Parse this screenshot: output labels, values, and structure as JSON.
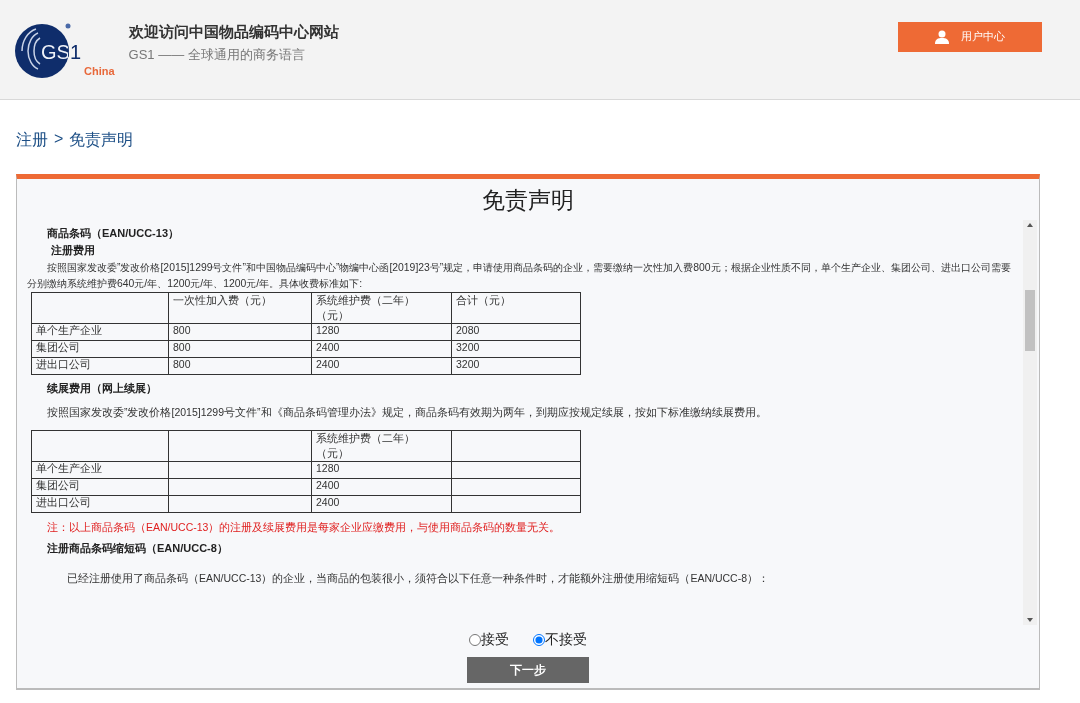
{
  "header": {
    "logo": {
      "mark": "GS1",
      "region": "China"
    },
    "title": "欢迎访问中国物品编码中心网站",
    "subtitle": "GS1 —— 全球通用的商务语言",
    "user_center_button": "用户中心"
  },
  "breadcrumb": {
    "items": [
      "注册",
      "免责声明"
    ],
    "separator": ">"
  },
  "panel": {
    "title": "免责声明",
    "blocks": [
      {
        "kind": "heading",
        "text": "商品条码（EAN/UCC-13）"
      },
      {
        "kind": "subheading",
        "text": "注册费用"
      },
      {
        "kind": "paragraph",
        "text": "按照国家发改委”发改价格[2015]1299号文件”和中国物品编码中心”物编中心函[2019]23号”规定，申请使用商品条码的企业，需要缴纳一次性加入费800元；根据企业性质不同，单个生产企业、集团公司、进出口公司需要分别缴纳系统维护费640元/年、1200元/年、1200元/年。具体收费标准如下:"
      },
      {
        "kind": "table",
        "columns": [
          "",
          "一次性加入费（元）",
          "系统维护费（二年）（元）",
          "合计（元）"
        ],
        "rows": [
          [
            "单个生产企业",
            "800",
            "1280",
            "2080"
          ],
          [
            "集团公司",
            "800",
            "2400",
            "3200"
          ],
          [
            "进出口公司",
            "800",
            "2400",
            "3200"
          ]
        ]
      },
      {
        "kind": "heading",
        "text": "续展费用（网上续展）"
      },
      {
        "kind": "paragraph",
        "text": "按照国家发改委”发改价格[2015]1299号文件”和《商品条码管理办法》规定，商品条码有效期为两年，到期应按规定续展，按如下标准缴纳续展费用。"
      },
      {
        "kind": "table",
        "columns": [
          "",
          "",
          "系统维护费（二年）（元）",
          ""
        ],
        "rows": [
          [
            "单个生产企业",
            "",
            "1280",
            ""
          ],
          [
            "集团公司",
            "",
            "2400",
            ""
          ],
          [
            "进出口公司",
            "",
            "2400",
            ""
          ]
        ]
      },
      {
        "kind": "note",
        "text": "注：以上商品条码（EAN/UCC-13）的注册及续展费用是每家企业应缴费用，与使用商品条码的数量无关。"
      },
      {
        "kind": "heading",
        "text": "注册商品条码缩短码（EAN/UCC-8）"
      },
      {
        "kind": "indented",
        "text": "已经注册使用了商品条码（EAN/UCC-13）的企业，当商品的包装很小，须符合以下任意一种条件时，才能额外注册使用缩短码（EAN/UCC-8）："
      }
    ]
  },
  "consent": {
    "options": [
      {
        "label": "接受",
        "selected": false
      },
      {
        "label": "不接受",
        "selected": true
      }
    ]
  },
  "next_button": "下一步"
}
